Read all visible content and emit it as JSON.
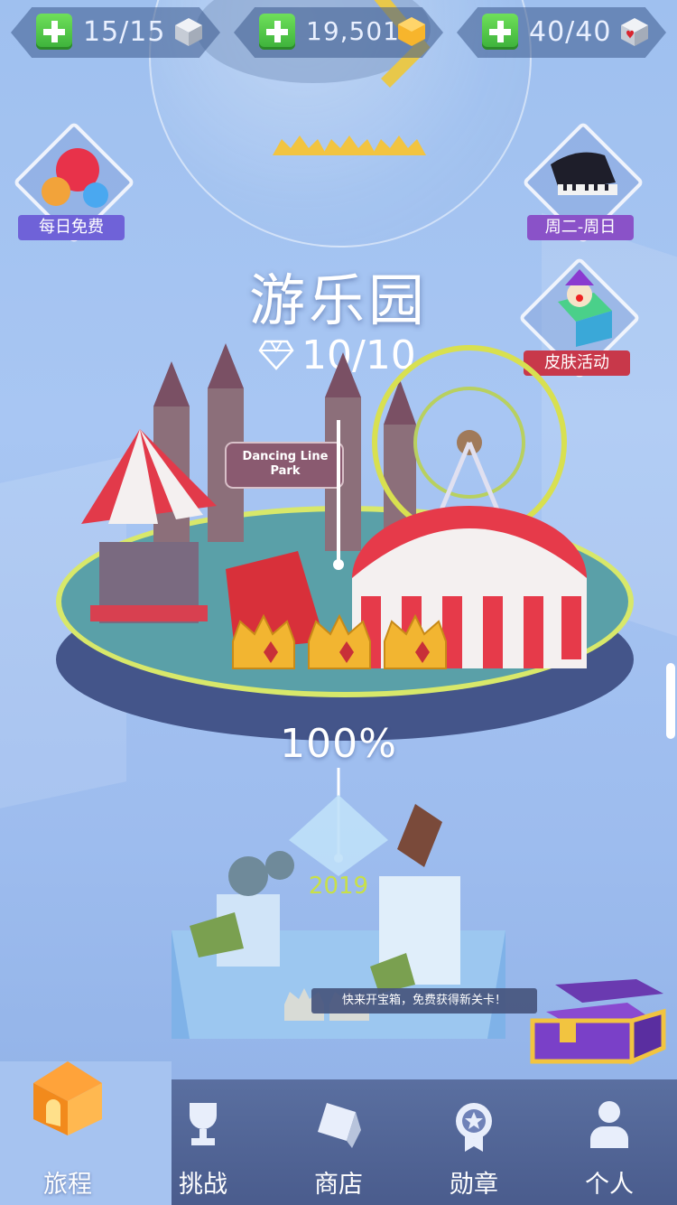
{
  "resources": [
    {
      "value": "15/15",
      "icon": "gray-cube-icon"
    },
    {
      "value": "19,501",
      "icon": "gold-gem-icon"
    },
    {
      "value": "40/40",
      "icon": "heart-cube-icon"
    }
  ],
  "events": {
    "daily": {
      "label": "每日免费",
      "icon": "gem-balloons-icon"
    },
    "weekly": {
      "label": "周二-周日",
      "icon": "piano-icon"
    },
    "skin": {
      "label": "皮肤活动",
      "icon": "jester-box-icon"
    }
  },
  "level": {
    "name": "游乐园",
    "gems": "10/10",
    "progress": "100%",
    "sign": "Dancing Line Park"
  },
  "next_level": {
    "year": "2019"
  },
  "chest": {
    "tooltip": "快来开宝箱，免费获得新关卡！"
  },
  "nav": [
    {
      "label": "旅程",
      "icon": "house-icon"
    },
    {
      "label": "挑战",
      "icon": "trophy-icon"
    },
    {
      "label": "商店",
      "icon": "shop-icon"
    },
    {
      "label": "勋章",
      "icon": "medal-icon"
    },
    {
      "label": "个人",
      "icon": "person-icon"
    }
  ],
  "colors": {
    "accent_green": "#4cc84a",
    "gold": "#f2b531",
    "nav_bg": "#4a5c8d",
    "daily_tag": "#6f62d8",
    "weekly_tag": "#8a52c8",
    "skin_tag": "#c8384a"
  }
}
